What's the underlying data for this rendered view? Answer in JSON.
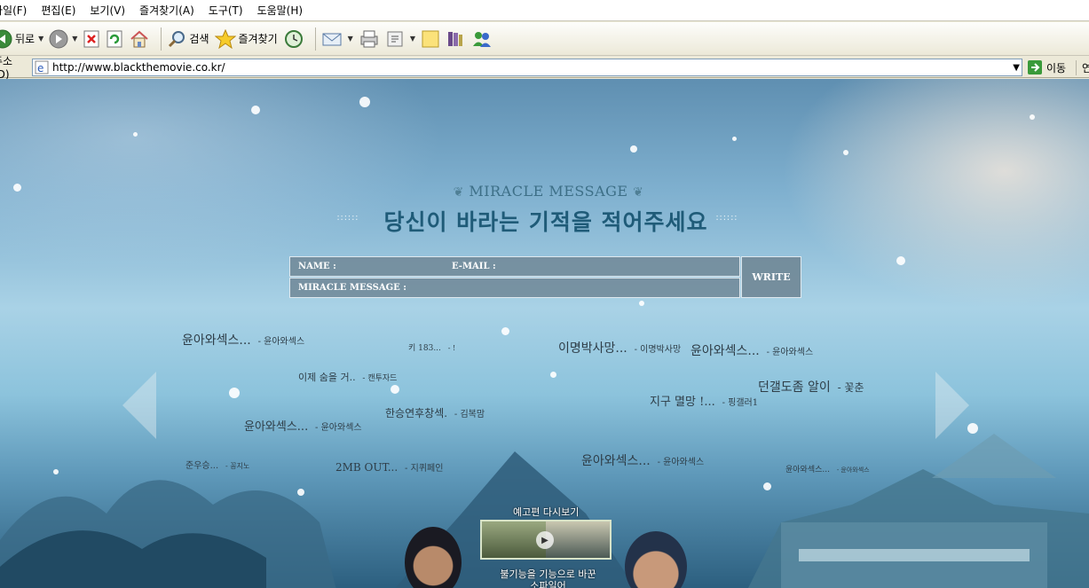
{
  "menu": [
    "파일(F)",
    "편집(E)",
    "보기(V)",
    "즐겨찾기(A)",
    "도구(T)",
    "도움말(H)"
  ],
  "toolbar": {
    "back_label": "뒤로",
    "search_label": "검색",
    "favorites_label": "즐겨찾기"
  },
  "address": {
    "label": "주소(D)",
    "url": "http://www.blackthemovie.co.kr/",
    "go_label": "이동",
    "links_label": "연"
  },
  "page": {
    "mm_title": "MIRACLE MESSAGE",
    "mm_heading": "당신이 바라는 기적을 적어주세요",
    "form": {
      "name_label": "NAME :",
      "email_label": "E-MAIL :",
      "message_label": "MIRACLE MESSAGE :",
      "write_label": "WRITE"
    },
    "messages": [
      {
        "text": "윤아와섹스...",
        "author": "윤아와섹스"
      },
      {
        "text": "키 183...",
        "author": "!"
      },
      {
        "text": "이명박사망...",
        "author": "이명박사망"
      },
      {
        "text": "윤아와섹스...",
        "author": "윤아와섹스"
      },
      {
        "text": "이제 숨을 거..",
        "author": "캔투자드"
      },
      {
        "text": "던갤도좀 알이",
        "author": "꽃춘"
      },
      {
        "text": "지구 멸망 !...",
        "author": "핑갤러1"
      },
      {
        "text": "한승연후창섹.",
        "author": "김복맘"
      },
      {
        "text": "윤아와섹스...",
        "author": "윤아와섹스"
      },
      {
        "text": "준우승...",
        "author": "꽁지노"
      },
      {
        "text": "2MB OUT...",
        "author": "지퀴페인"
      },
      {
        "text": "윤아와섹스...",
        "author": "윤아와섹스"
      },
      {
        "text": "윤아와섹스...",
        "author": "윤아와섹스"
      }
    ],
    "trailer_label": "예고편 다시보기",
    "bottom_note": "불기능을 기능으로 바꾼 소파일어"
  },
  "colors": {
    "heading": "#1f5b78",
    "form_bg": "#708796",
    "sky_top": "#5f8fb1"
  }
}
